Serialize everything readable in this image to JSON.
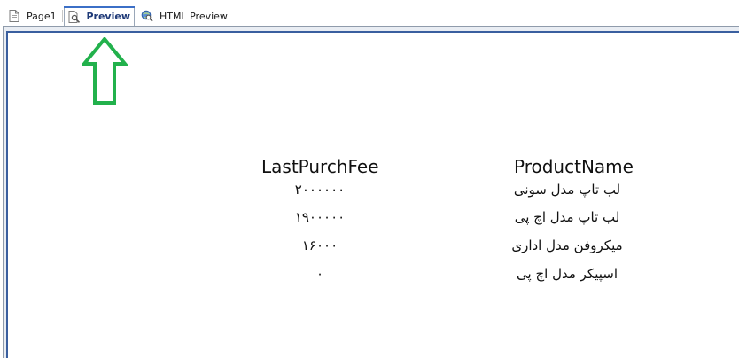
{
  "tabs": [
    {
      "label": "Page1",
      "icon": "page-icon",
      "active": false
    },
    {
      "label": "Preview",
      "icon": "preview-icon",
      "active": true
    },
    {
      "label": "HTML Preview",
      "icon": "html-preview-icon",
      "active": false
    }
  ],
  "annotation": {
    "icon": "up-arrow-icon",
    "color": "#22b14c"
  },
  "accent_color": "#3a5f9f",
  "report": {
    "headers": {
      "fee": "LastPurchFee",
      "name": "ProductName"
    },
    "rows": [
      {
        "fee": "۲۰۰۰۰۰۰",
        "name": "لب تاپ مدل سونی"
      },
      {
        "fee": "۱۹۰۰۰۰۰",
        "name": "لب تاپ مدل اچ پی"
      },
      {
        "fee": "۱۶۰۰۰",
        "name": "میکروفن مدل اداری"
      },
      {
        "fee": "۰",
        "name": "اسپیکر مدل اچ پی"
      }
    ]
  }
}
